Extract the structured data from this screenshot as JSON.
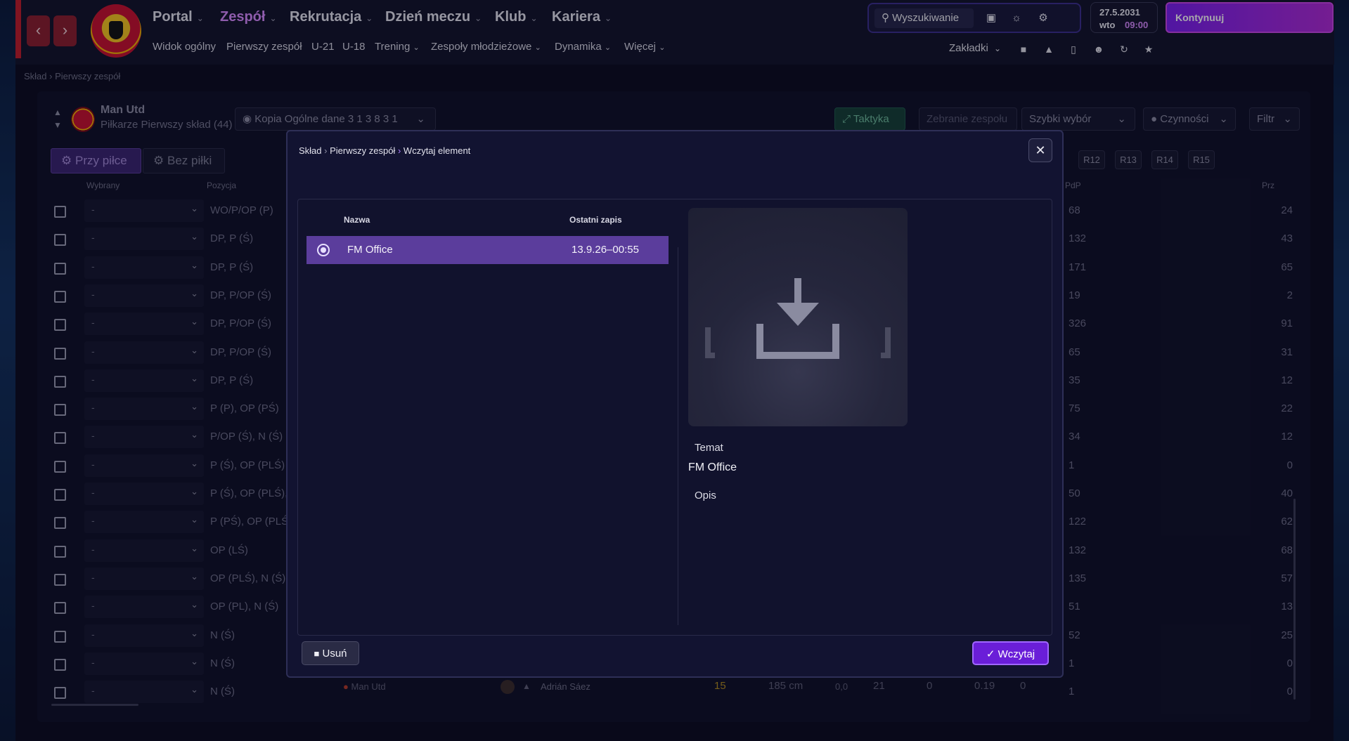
{
  "topbar": {
    "nav_main": [
      {
        "label": "Portal"
      },
      {
        "label": "Zespół"
      },
      {
        "label": "Rekrutacja"
      },
      {
        "label": "Dzień meczu"
      },
      {
        "label": "Klub"
      },
      {
        "label": "Kariera"
      }
    ],
    "nav_sub": [
      {
        "label": "Widok ogólny"
      },
      {
        "label": "Pierwszy zespół"
      },
      {
        "label": "U-21"
      },
      {
        "label": "U-18"
      },
      {
        "label": "Trening"
      },
      {
        "label": "Zespoły młodzieżowe"
      },
      {
        "label": "Dynamika"
      },
      {
        "label": "Więcej"
      }
    ],
    "search_label": "Wyszukiwanie",
    "date": "27.5.2031",
    "day": "wto",
    "time": "09:00",
    "continue_label": "Kontynuuj",
    "bookmarks_label": "Zakładki",
    "active_color": "#d88aff",
    "accent": "#8b2ff0"
  },
  "breadcrumb": {
    "root": "Skład",
    "current": "Pierwszy zespół"
  },
  "squad_header": {
    "team_name": "Man Utd",
    "subtitle": "Piłkarze Pierwszy skład (44)",
    "view_label": "Kopia Ogólne dane 3 1 3 8 3 1",
    "tactics_label": "Taktyka",
    "team_meeting_label": "Zebranie zespołu",
    "quick_select_label": "Szybki wybór",
    "actions_label": "Czynności",
    "filter_label": "Filtr",
    "tab_in_possession": "Przy piłce",
    "tab_out_possession": "Bez piłki",
    "r_tags": [
      "R12",
      "R13",
      "R14",
      "R15"
    ]
  },
  "table": {
    "col_selected": "Wybrany",
    "col_position": "Pozycja",
    "col_pdp": "PdP",
    "col_prz": "Prz",
    "rows": [
      {
        "sel": "-",
        "pos": "WO/P/OP (P)",
        "pdp": "68",
        "prz": "24"
      },
      {
        "sel": "-",
        "pos": "DP, P (Ś)",
        "pdp": "132",
        "prz": "43"
      },
      {
        "sel": "-",
        "pos": "DP, P (Ś)",
        "pdp": "171",
        "prz": "65"
      },
      {
        "sel": "-",
        "pos": "DP, P/OP (Ś)",
        "pdp": "19",
        "prz": "2"
      },
      {
        "sel": "-",
        "pos": "DP, P/OP (Ś)",
        "pdp": "326",
        "prz": "91"
      },
      {
        "sel": "-",
        "pos": "DP, P/OP (Ś)",
        "pdp": "65",
        "prz": "31"
      },
      {
        "sel": "-",
        "pos": "DP, P (Ś)",
        "pdp": "35",
        "prz": "12"
      },
      {
        "sel": "-",
        "pos": "P (P), OP (PŚ)",
        "pdp": "75",
        "prz": "22"
      },
      {
        "sel": "-",
        "pos": "P/OP (Ś), N (Ś)",
        "pdp": "34",
        "prz": "12"
      },
      {
        "sel": "-",
        "pos": "P (Ś), OP (PLŚ)",
        "pdp": "1",
        "prz": "0"
      },
      {
        "sel": "-",
        "pos": "P (Ś), OP (PLŚ),",
        "pdp": "50",
        "prz": "40"
      },
      {
        "sel": "-",
        "pos": "P (PŚ), OP (PLŚ",
        "pdp": "122",
        "prz": "62"
      },
      {
        "sel": "-",
        "pos": "OP (LŚ)",
        "pdp": "132",
        "prz": "68"
      },
      {
        "sel": "-",
        "pos": "OP (PLŚ), N (Ś)",
        "pdp": "135",
        "prz": "57"
      },
      {
        "sel": "-",
        "pos": "OP (PL), N (Ś)",
        "pdp": "51",
        "prz": "13"
      },
      {
        "sel": "-",
        "pos": "N (Ś)",
        "pdp": "52",
        "prz": "25"
      },
      {
        "sel": "-",
        "pos": "N (Ś)",
        "pdp": "1",
        "prz": "0"
      },
      {
        "sel": "-",
        "pos": "N (Ś)",
        "pdp": "1",
        "prz": "0"
      }
    ],
    "last_row_extra": {
      "club": "Man Utd",
      "player": "Adrián Sáez",
      "number": "15",
      "height": "185 cm",
      "v1": "0,0",
      "v2": "21",
      "v3": "0",
      "v4": "0.19",
      "v5": "0"
    }
  },
  "modal": {
    "crumb_1": "Skład",
    "crumb_2": "Pierwszy zespół",
    "crumb_3": "Wczytaj element",
    "col_name": "Nazwa",
    "col_last_save": "Ostatni zapis",
    "items": [
      {
        "name": "FM Office",
        "date": "13.9.26–00:55"
      }
    ],
    "theme_label": "Temat",
    "theme_value": "FM Office",
    "description_label": "Opis",
    "delete_label": "Usuń",
    "load_label": "Wczytaj",
    "selected_color": "#5b3d9c"
  }
}
